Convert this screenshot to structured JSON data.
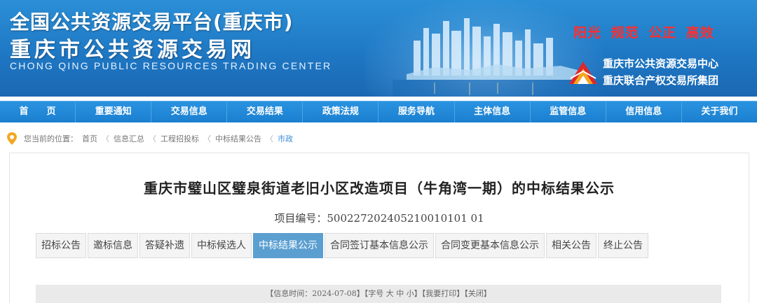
{
  "header": {
    "title_main": "全国公共资源交易平台(重庆市)",
    "title_sub": "重庆市公共资源交易网",
    "title_en": "CHONG QING PUBLIC RESOURCES TRADING CENTER",
    "slogan": "阳光  规范  公正  高效",
    "org_line1": "重庆市公共资源交易中心",
    "org_line2": "重庆联合产权交易所集团"
  },
  "nav": {
    "items": [
      "首　　页",
      "重要通知",
      "交易信息",
      "交易结果",
      "政策法规",
      "服务导航",
      "主体信息",
      "监管信息",
      "信用信息",
      "关于我们"
    ]
  },
  "breadcrumb": {
    "prefix": "您当前的位置：",
    "items": [
      "首页",
      "信息汇总",
      "工程招投标",
      "中标结果公告",
      "市政"
    ],
    "separator": "〈"
  },
  "article": {
    "title": "重庆市璧山区璧泉街道老旧小区改造项目（牛角湾一期）的中标结果公示",
    "project_no": "项目编号：500227202405210010101 01"
  },
  "tabs": {
    "items": [
      "招标公告",
      "邀标信息",
      "答疑补遗",
      "中标候选人",
      "中标结果公示",
      "合同签订基本信息公示",
      "合同变更基本信息公示",
      "相关公告",
      "终止公告"
    ],
    "active_index": 4
  },
  "info_bar": {
    "time": "【信息时间：2024-07-08】",
    "font": "【字号 大 中 小】",
    "print": "【我要打印】",
    "close": "【关闭】"
  },
  "colors": {
    "banner": "#1f78c4",
    "nav": "#1b7fd0",
    "slogan": "#ff2d2d",
    "active_tab": "#5b9fd1",
    "pin": "#f5a623"
  },
  "icons": {
    "location": "location-pin-icon",
    "logo": "trading-center-logo-icon"
  }
}
